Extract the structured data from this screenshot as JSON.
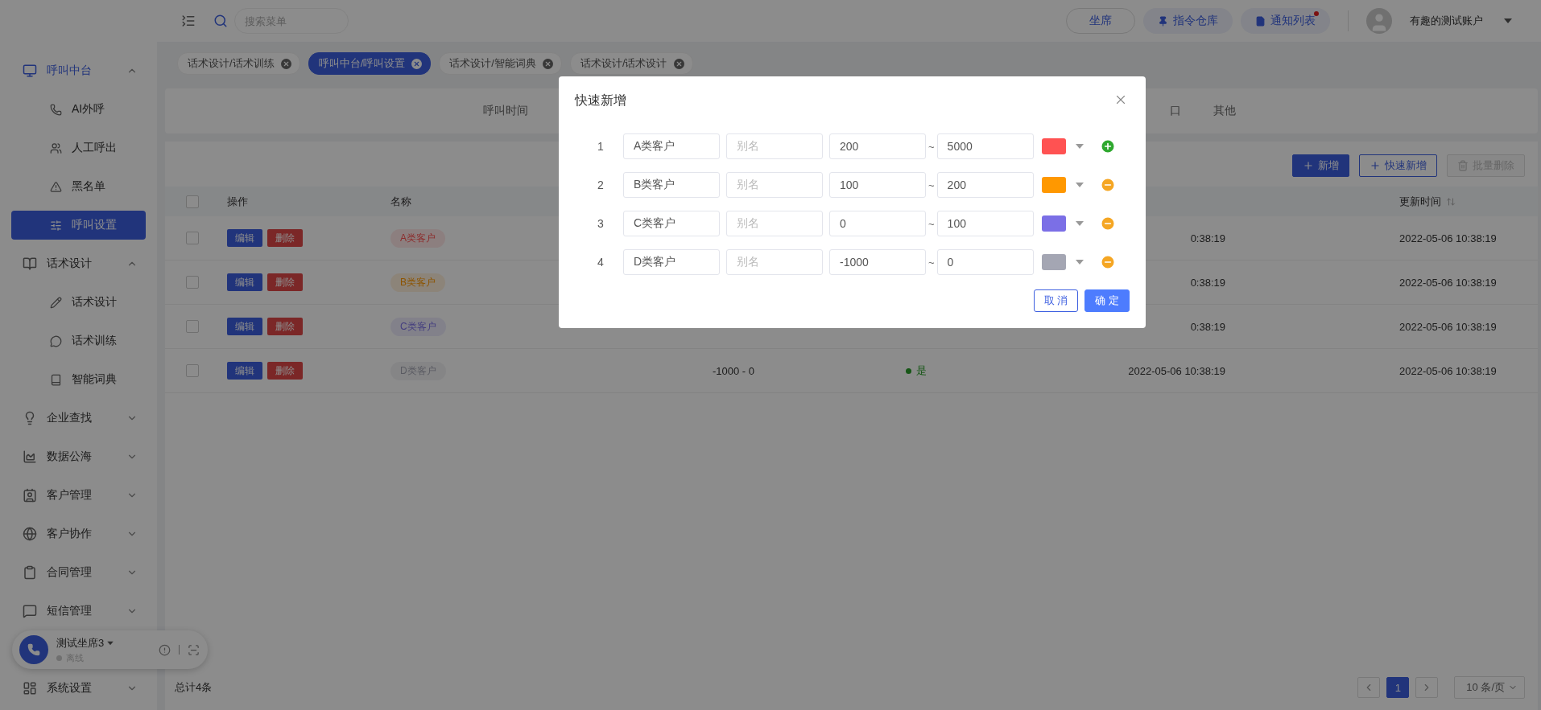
{
  "header": {
    "search": {
      "placeholder": "搜索菜单"
    },
    "actions": [
      {
        "label": "坐席",
        "kind": "outline",
        "badge": false
      },
      {
        "label": "指令仓库",
        "kind": "pin",
        "badge": false
      },
      {
        "label": "通知列表",
        "kind": "note",
        "badge": true
      }
    ],
    "user": {
      "name": "有趣的测试账户"
    }
  },
  "sidebar": {
    "items": [
      {
        "label": "呼叫中台",
        "expanded": true,
        "children": [
          {
            "label": "AI外呼",
            "selected": false
          },
          {
            "label": "人工呼出",
            "selected": false
          },
          {
            "label": "黑名单",
            "selected": false
          },
          {
            "label": "呼叫设置",
            "selected": true
          }
        ]
      },
      {
        "label": "话术设计",
        "expanded": true,
        "children": [
          {
            "label": "话术设计",
            "selected": false
          },
          {
            "label": "话术训练",
            "selected": false
          },
          {
            "label": "智能词典",
            "selected": false
          }
        ]
      },
      {
        "label": "企业查找",
        "expanded": false
      },
      {
        "label": "数据公海",
        "expanded": false
      },
      {
        "label": "客户管理",
        "expanded": false
      },
      {
        "label": "客户协作",
        "expanded": false
      },
      {
        "label": "合同管理",
        "expanded": false
      },
      {
        "label": "短信管理",
        "expanded": false
      },
      {
        "label": "系统设置",
        "expanded": false
      }
    ]
  },
  "agent_widget": {
    "name": "测试坐席3",
    "status": "离线"
  },
  "page_tabs": [
    {
      "label": "话术设计/话术训练",
      "selected": false
    },
    {
      "label": "呼叫中台/呼叫设置",
      "selected": true
    },
    {
      "label": "话术设计/智能词典",
      "selected": false
    },
    {
      "label": "话术设计/话术设计",
      "selected": false
    }
  ],
  "filter_tabs": [
    {
      "label": "呼叫时间"
    },
    {
      "label": "口"
    },
    {
      "label": "其他"
    }
  ],
  "toolbar": {
    "buttons": [
      {
        "label": "新增",
        "kind": "primary",
        "disabled": false
      },
      {
        "label": "快速新增",
        "kind": "outline",
        "disabled": false
      },
      {
        "label": "批量删除",
        "kind": "outline",
        "disabled": true
      }
    ]
  },
  "table": {
    "all_checked": false,
    "columns": [
      {
        "label": "操作"
      },
      {
        "label": "名称"
      },
      {
        "label": "更新时间",
        "sortable": true
      }
    ],
    "rows": [
      {
        "checked": false,
        "actions": [
          "编辑",
          "删除"
        ],
        "name": "A类客户",
        "created": "0:38:19",
        "updated": "2022-05-06 10:38:19"
      },
      {
        "checked": false,
        "actions": [
          "编辑",
          "删除"
        ],
        "name": "B类客户",
        "created": "0:38:19",
        "updated": "2022-05-06 10:38:19"
      },
      {
        "checked": false,
        "actions": [
          "编辑",
          "删除"
        ],
        "name": "C类客户",
        "created": "0:38:19",
        "updated": "2022-05-06 10:38:19"
      },
      {
        "checked": false,
        "actions": [
          "编辑",
          "删除"
        ],
        "name": "D类客户",
        "range": "-1000 - 0",
        "status": "是",
        "created": "2022-05-06 10:38:19",
        "updated": "2022-05-06 10:38:19"
      }
    ]
  },
  "footer": {
    "total": "总计4条",
    "pages": [
      {
        "label": "1",
        "selected": true
      }
    ],
    "page_size": "10 条/页"
  },
  "dialog": {
    "title": "快速新增",
    "rows": [
      {
        "index": "1",
        "name": "A类客户",
        "alias_placeholder": "别名",
        "min": "200",
        "separator": "~",
        "max": "5000",
        "color": "#ff5252",
        "kind": "add"
      },
      {
        "index": "2",
        "name": "B类客户",
        "alias_placeholder": "别名",
        "min": "100",
        "separator": "~",
        "max": "200",
        "color": "#ff9800",
        "kind": "remove"
      },
      {
        "index": "3",
        "name": "C类客户",
        "alias_placeholder": "别名",
        "min": "0",
        "separator": "~",
        "max": "100",
        "color": "#7b6fe6",
        "kind": "remove"
      },
      {
        "index": "4",
        "name": "D类客户",
        "alias_placeholder": "别名",
        "min": "-1000",
        "separator": "~",
        "max": "0",
        "color": "#a4a6b3",
        "kind": "remove"
      }
    ],
    "buttons": [
      {
        "label": "取 消",
        "kind": "outline"
      },
      {
        "label": "确 定",
        "kind": "primary"
      }
    ]
  }
}
